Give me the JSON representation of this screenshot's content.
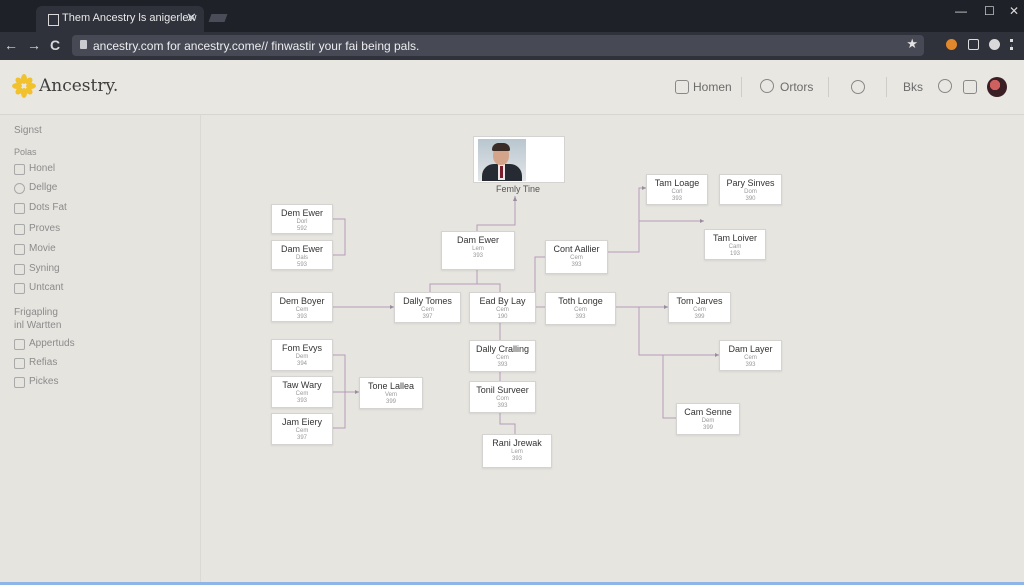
{
  "browser": {
    "tab_title": "Them Ancestry ls anigerlew",
    "tab_close": "✕",
    "back": "←",
    "forward": "→",
    "reload": "C",
    "url": "ancestry.com for ancestry.come// finwastir your fai being pals.",
    "star": "★",
    "win_min": "—",
    "win_max": "☐",
    "win_close": "✕"
  },
  "header": {
    "logo_text": "Ancestry.",
    "logo_color": "#f2c12e",
    "nav_home": "Homen",
    "nav_orders": "Ortors",
    "nav_links": "Bks"
  },
  "sidebar": {
    "title": "Signst",
    "section1": "Polas",
    "items": [
      "Honel",
      "Dellge",
      "Dots Fat",
      "Proves",
      "Movie",
      "Syning",
      "Untcant"
    ],
    "section2a": "Frigapling",
    "section2b": "inl Wartten",
    "items2": [
      "Appertuds",
      "Refias",
      "Pickes"
    ]
  },
  "tree": {
    "root_label": "Femly Tine",
    "nodes": [
      {
        "name": "Dem Ewer",
        "sub": "Dorl",
        "dates": "592"
      },
      {
        "name": "Dam Ewer",
        "sub": "Dals",
        "dates": "593"
      },
      {
        "name": "Dem Boyer",
        "sub": "Cem",
        "dates": "393"
      },
      {
        "name": "Fom Evys",
        "sub": "Dem",
        "dates": "394"
      },
      {
        "name": "Taw Wary",
        "sub": "Cem",
        "dates": "393"
      },
      {
        "name": "Jam Eiery",
        "sub": "Cem",
        "dates": "397"
      },
      {
        "name": "Dam Ewer",
        "sub": "Lem",
        "dates": "393"
      },
      {
        "name": "Dally Tomes",
        "sub": "Cem",
        "dates": "397"
      },
      {
        "name": "Ead By Lay",
        "sub": "Cem",
        "dates": "190"
      },
      {
        "name": "Tone Lallea",
        "sub": "Vem",
        "dates": "399"
      },
      {
        "name": "Dally Cralling",
        "sub": "Cem",
        "dates": "393"
      },
      {
        "name": "Tonil Surveer",
        "sub": "Com",
        "dates": "393"
      },
      {
        "name": "Rani Jrewak",
        "sub": "Lem",
        "dates": "393"
      },
      {
        "name": "Cont Aallier",
        "sub": "Cem",
        "dates": "393"
      },
      {
        "name": "Toth Longe",
        "sub": "Cem",
        "dates": "393"
      },
      {
        "name": "Tam Loage",
        "sub": "Corl",
        "dates": "393"
      },
      {
        "name": "Pary Sinves",
        "sub": "Dom",
        "dates": "390"
      },
      {
        "name": "Tam Loiver",
        "sub": "Cam",
        "dates": "193"
      },
      {
        "name": "Tom Jarves",
        "sub": "Cem",
        "dates": "399"
      },
      {
        "name": "Dam Layer",
        "sub": "Cem",
        "dates": "393"
      },
      {
        "name": "Cam Senne",
        "sub": "Dem",
        "dates": "399"
      }
    ]
  }
}
